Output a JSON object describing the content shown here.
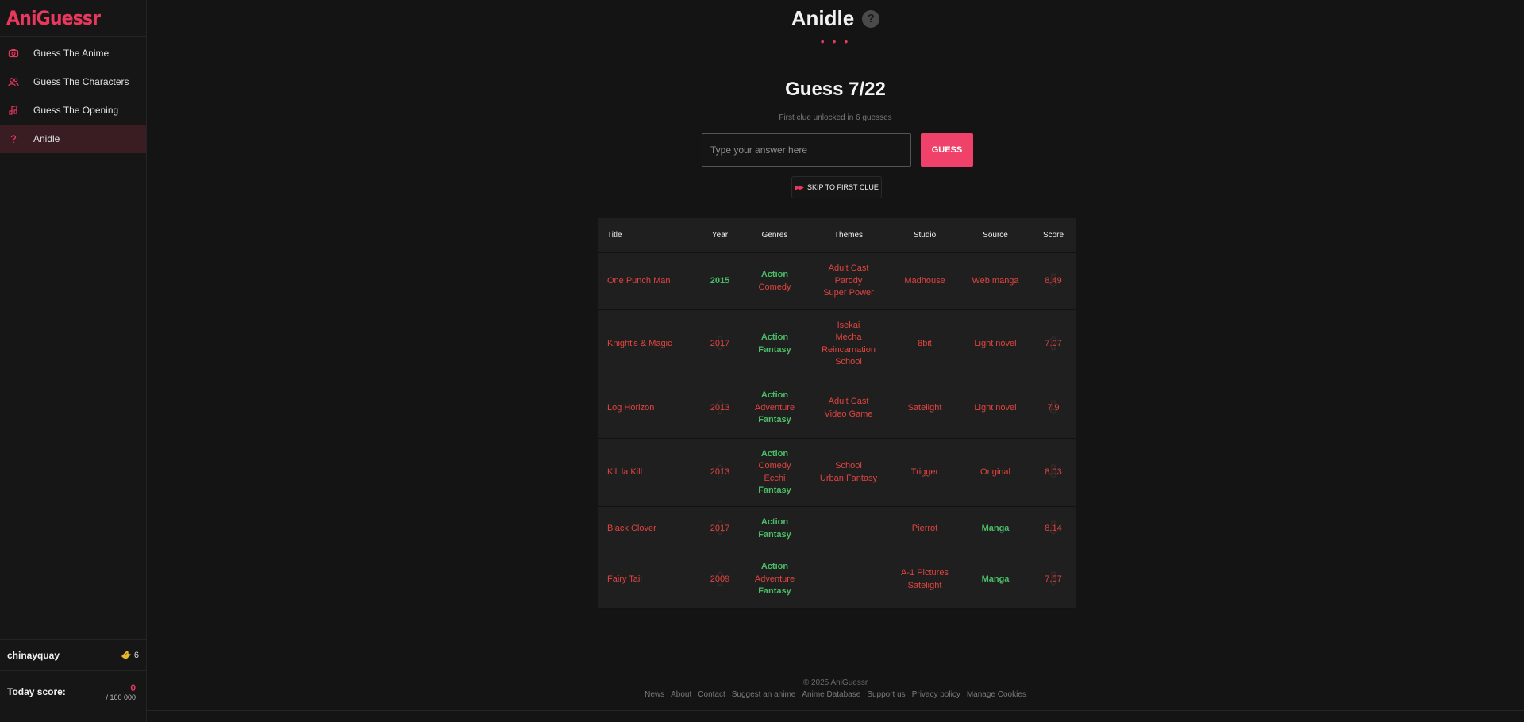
{
  "brand": {
    "logo": "AniGuessr",
    "accent": "#e8385e"
  },
  "sidebar": {
    "items": [
      {
        "label": "Guess The Anime",
        "icon": "camera-icon"
      },
      {
        "label": "Guess The Characters",
        "icon": "users-icon"
      },
      {
        "label": "Guess The Opening",
        "icon": "music-icon"
      },
      {
        "label": "Anidle",
        "icon": "question-icon",
        "active": true
      }
    ],
    "user": {
      "name": "chinayquay",
      "tickets": "6"
    },
    "score": {
      "label": "Today score:",
      "value": "0",
      "max": "/ 100 000"
    }
  },
  "main": {
    "title": "Anidle",
    "help": "?",
    "dots": "• • •",
    "guess_counter": "Guess 7/22",
    "clue_note": "First clue unlocked in 6 guesses",
    "input_placeholder": "Type your answer here",
    "guess_button": "GUESS",
    "skip_button": "SKIP TO FIRST CLUE"
  },
  "table": {
    "headers": [
      "Title",
      "Year",
      "Genres",
      "Themes",
      "Studio",
      "Source",
      "Score"
    ],
    "rows": [
      {
        "title": "One Punch Man",
        "year": {
          "value": "2015",
          "match": true,
          "arrow": ""
        },
        "genres": [
          {
            "v": "Action",
            "m": true
          },
          {
            "v": "Comedy",
            "m": false
          }
        ],
        "themes": [
          {
            "v": "Adult Cast",
            "m": false
          },
          {
            "v": "Parody",
            "m": false
          },
          {
            "v": "Super Power",
            "m": false
          }
        ],
        "studio": [
          {
            "v": "Madhouse",
            "m": false
          }
        ],
        "source": {
          "value": "Web manga",
          "match": false
        },
        "score": {
          "value": "8.49",
          "arrow": "down"
        }
      },
      {
        "title": "Knight's & Magic",
        "year": {
          "value": "2017",
          "match": false,
          "arrow": "down"
        },
        "genres": [
          {
            "v": "Action",
            "m": true
          },
          {
            "v": "Fantasy",
            "m": true
          }
        ],
        "themes": [
          {
            "v": "Isekai",
            "m": false
          },
          {
            "v": "Mecha",
            "m": false
          },
          {
            "v": "Reincarnation",
            "m": false
          },
          {
            "v": "School",
            "m": false
          }
        ],
        "studio": [
          {
            "v": "8bit",
            "m": false
          }
        ],
        "source": {
          "value": "Light novel",
          "match": false
        },
        "score": {
          "value": "7.07",
          "arrow": "up"
        }
      },
      {
        "title": "Log Horizon",
        "year": {
          "value": "2013",
          "match": false,
          "arrow": "up"
        },
        "genres": [
          {
            "v": "Action",
            "m": true
          },
          {
            "v": "Adventure",
            "m": false
          },
          {
            "v": "Fantasy",
            "m": true
          }
        ],
        "themes": [
          {
            "v": "Adult Cast",
            "m": false
          },
          {
            "v": "Video Game",
            "m": false
          }
        ],
        "studio": [
          {
            "v": "Satelight",
            "m": false
          }
        ],
        "source": {
          "value": "Light novel",
          "match": false
        },
        "score": {
          "value": "7.9",
          "arrow": "down"
        }
      },
      {
        "title": "Kill la Kill",
        "year": {
          "value": "2013",
          "match": false,
          "arrow": "up"
        },
        "genres": [
          {
            "v": "Action",
            "m": true
          },
          {
            "v": "Comedy",
            "m": false
          },
          {
            "v": "Ecchi",
            "m": false
          },
          {
            "v": "Fantasy",
            "m": true
          }
        ],
        "themes": [
          {
            "v": "School",
            "m": false
          },
          {
            "v": "Urban Fantasy",
            "m": false
          }
        ],
        "studio": [
          {
            "v": "Trigger",
            "m": false
          }
        ],
        "source": {
          "value": "Original",
          "match": false
        },
        "score": {
          "value": "8.03",
          "arrow": "down"
        }
      },
      {
        "title": "Black Clover",
        "year": {
          "value": "2017",
          "match": false,
          "arrow": "down"
        },
        "genres": [
          {
            "v": "Action",
            "m": true
          },
          {
            "v": "Fantasy",
            "m": true
          }
        ],
        "themes": [],
        "studio": [
          {
            "v": "Pierrot",
            "m": false
          }
        ],
        "source": {
          "value": "Manga",
          "match": true
        },
        "score": {
          "value": "8.14",
          "arrow": "down"
        }
      },
      {
        "title": "Fairy Tail",
        "year": {
          "value": "2009",
          "match": false,
          "arrow": "up"
        },
        "genres": [
          {
            "v": "Action",
            "m": true
          },
          {
            "v": "Adventure",
            "m": false
          },
          {
            "v": "Fantasy",
            "m": true
          }
        ],
        "themes": [],
        "studio": [
          {
            "v": "A-1 Pictures",
            "m": false
          },
          {
            "v": "Satelight",
            "m": false
          }
        ],
        "source": {
          "value": "Manga",
          "match": true
        },
        "score": {
          "value": "7.57",
          "arrow": "down"
        }
      }
    ]
  },
  "footer": {
    "copyright": "© 2025 AniGuessr",
    "links": [
      "News",
      "About",
      "Contact",
      "Suggest an anime",
      "Anime Database",
      "Support us",
      "Privacy policy",
      "Manage Cookies"
    ]
  }
}
